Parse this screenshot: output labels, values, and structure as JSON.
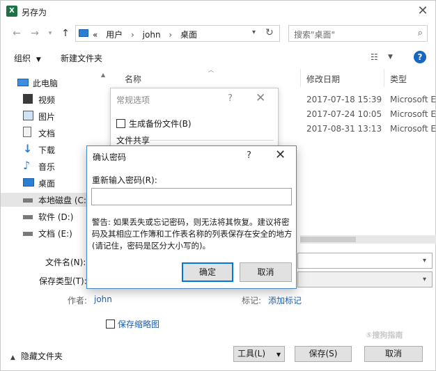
{
  "window": {
    "title": "另存为",
    "app_icon": "excel-icon"
  },
  "address_bar": {
    "segments": [
      "«",
      "用户",
      "john",
      "桌面"
    ]
  },
  "search": {
    "placeholder": "搜索\"桌面\""
  },
  "toolbar": {
    "organize": "组织",
    "new_folder": "新建文件夹"
  },
  "sidebar": {
    "items": [
      {
        "label": "此电脑",
        "icon": "computer-icon"
      },
      {
        "label": "视频",
        "icon": "video-icon"
      },
      {
        "label": "图片",
        "icon": "picture-icon"
      },
      {
        "label": "文档",
        "icon": "document-icon"
      },
      {
        "label": "下载",
        "icon": "download-icon"
      },
      {
        "label": "音乐",
        "icon": "music-icon"
      },
      {
        "label": "桌面",
        "icon": "desktop-icon"
      },
      {
        "label": "本地磁盘 (C:)",
        "icon": "drive-icon"
      },
      {
        "label": "软件 (D:)",
        "icon": "drive-icon"
      },
      {
        "label": "文档 (E:)",
        "icon": "drive-icon"
      }
    ]
  },
  "file_list": {
    "columns": {
      "name": "名称",
      "modified": "修改日期",
      "type": "类型"
    },
    "rows": [
      {
        "modified": "2017-07-18 15:39",
        "type": "Microsoft E"
      },
      {
        "modified": "2017-07-24 10:05",
        "type": "Microsoft E"
      },
      {
        "modified": "2017-08-31 13:13",
        "type": "Microsoft E"
      }
    ]
  },
  "form": {
    "filename_label": "文件名(N):",
    "filetype_label": "保存类型(T):",
    "author_label": "作者:",
    "author_value": "john",
    "tags_label": "标记:",
    "tags_link": "添加标记",
    "thumbnail_label": "保存缩略图"
  },
  "bottom": {
    "hide_folders": "隐藏文件夹",
    "tools": "工具(L)",
    "save": "保存(S)",
    "cancel": "取消"
  },
  "general_options_dialog": {
    "title": "常规选项",
    "help": "?",
    "backup_label": "生成备份文件(B)",
    "group_label": "文件共享"
  },
  "confirm_password_dialog": {
    "title": "确认密码",
    "help": "?",
    "reenter_label": "重新输入密码(R):",
    "password_value": "",
    "warning": "警告: 如果丢失或忘记密码，则无法将其恢复。建议将密码及其相应工作簿和工作表名称的列表保存在安全的地方(请记住，密码是区分大小写的)。",
    "ok": "确定",
    "cancel": "取消"
  },
  "watermark": "⑤搜狗指南",
  "colors": {
    "accent": "#0078d7",
    "link": "#1a5fb4",
    "excel": "#1e7145"
  }
}
